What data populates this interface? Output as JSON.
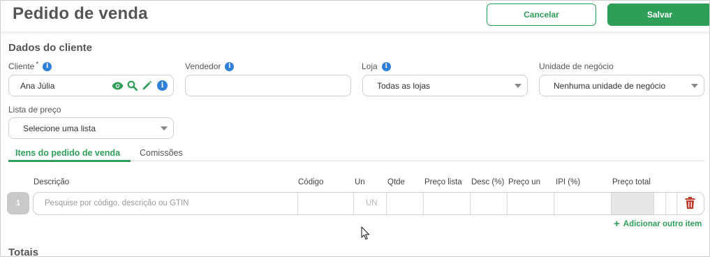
{
  "header": {
    "title": "Pedido de venda",
    "cancel_label": "Cancelar",
    "save_label": "Salvar"
  },
  "client_section": {
    "title": "Dados do cliente",
    "cliente_label": "Cliente",
    "cliente_required": "*",
    "cliente_value": "Ana Júlia",
    "vendedor_label": "Vendedor",
    "vendedor_value": "",
    "loja_label": "Loja",
    "loja_value": "Todas as lojas",
    "unidade_label": "Unidade de negócio",
    "unidade_value": "Nenhuma unidade de negócio",
    "lista_label": "Lista de preço",
    "lista_value": "Selecione uma lista"
  },
  "tabs": [
    {
      "label": "Itens do pedido de venda",
      "active": true
    },
    {
      "label": "Comissões",
      "active": false
    }
  ],
  "items_table": {
    "columns": [
      "Descrição",
      "Código",
      "Un",
      "Qtde",
      "Preço lista",
      "Desc (%)",
      "Preço un",
      "IPI (%)",
      "Preço total"
    ],
    "rows": [
      {
        "number": "1",
        "description_placeholder": "Pesquise por código, descrição ou GTIN",
        "un_placeholder": "UN"
      }
    ],
    "add_item_label": "Adicionar outro item"
  },
  "totals_title": "Totais",
  "colors": {
    "accent": "#2e9e59",
    "info": "#2f80d6",
    "danger": "#c0392b"
  },
  "icons": [
    "eye-icon",
    "search-icon",
    "pencil-icon",
    "info-icon",
    "trash-icon",
    "plus-icon",
    "caret-down-icon",
    "mouse-cursor-icon"
  ]
}
